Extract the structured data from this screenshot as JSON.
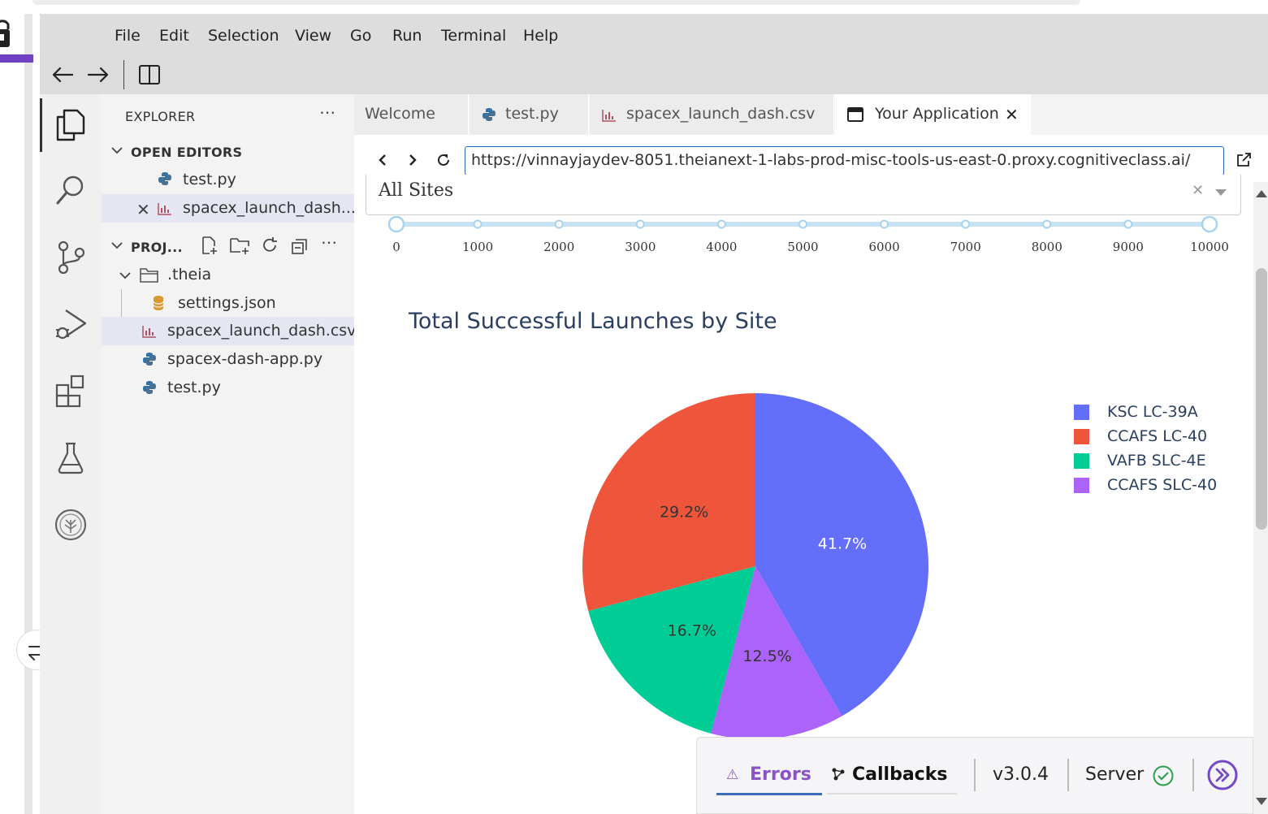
{
  "menu": [
    "File",
    "Edit",
    "Selection",
    "View",
    "Go",
    "Run",
    "Terminal",
    "Help"
  ],
  "explorer": {
    "title": "EXPLORER",
    "open_editors_label": "OPEN EDITORS",
    "open_editors": [
      "test.py",
      "spacex_launch_dash..."
    ],
    "project_label": "PROJ...",
    "tree": {
      "folder": ".theia",
      "folder_child": "settings.json",
      "files": [
        "spacex_launch_dash.csv",
        "spacex-dash-app.py",
        "test.py"
      ]
    }
  },
  "tabs": [
    "Welcome",
    "test.py",
    "spacex_launch_dash.csv",
    "Your Application"
  ],
  "browser": {
    "url": "https://vinnayjaydev-8051.theianext-1-labs-prod-misc-tools-us-east-0.proxy.cognitiveclass.ai/"
  },
  "app": {
    "dropdown_value": "All Sites",
    "slider_ticks": [
      "0",
      "1000",
      "2000",
      "3000",
      "4000",
      "5000",
      "6000",
      "7000",
      "8000",
      "9000",
      "10000"
    ],
    "slider_range": [
      0,
      10000
    ]
  },
  "chart_data": {
    "type": "pie",
    "title": "Total Successful Launches by Site",
    "labels": [
      "KSC LC-39A",
      "CCAFS LC-40",
      "VAFB SLC-4E",
      "CCAFS SLC-40"
    ],
    "values": [
      41.7,
      29.2,
      16.7,
      12.5
    ],
    "text_labels": [
      "41.7%",
      "29.2%",
      "16.7%",
      "12.5%"
    ],
    "colors": [
      "#636efa",
      "#EF553B",
      "#00cc96",
      "#ab63fa"
    ],
    "legend_position": "top-right"
  },
  "dash_debug": {
    "errors_label": "Errors",
    "callbacks_label": "Callbacks",
    "version": "v3.0.4",
    "server_label": "Server"
  }
}
